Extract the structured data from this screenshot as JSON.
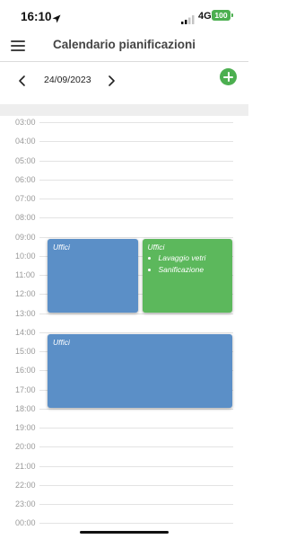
{
  "status_bar": {
    "time": "16:10",
    "network": "4G",
    "battery": "100",
    "location_icon": "location-arrow-icon",
    "signal_icon": "signal-bars-icon"
  },
  "header": {
    "title": "Calendario pianificazioni",
    "menu_icon": "hamburger-menu-icon"
  },
  "date_nav": {
    "date": "24/09/2023",
    "prev_icon": "chevron-left-icon",
    "next_icon": "chevron-right-icon",
    "add_icon": "add-circle-icon"
  },
  "timeline": {
    "hours": [
      "03:00",
      "04:00",
      "05:00",
      "06:00",
      "07:00",
      "08:00",
      "09:00",
      "10:00",
      "11:00",
      "12:00",
      "13:00",
      "14:00",
      "15:00",
      "16:00",
      "17:00",
      "18:00",
      "19:00",
      "20:00",
      "21:00",
      "22:00",
      "23:00",
      "00:00"
    ]
  },
  "events": [
    {
      "title": "Uffici",
      "start": "09:00",
      "end": "13:00",
      "column": 0,
      "columns": 2,
      "color": "#5b8fc7",
      "tasks": []
    },
    {
      "title": "Uffici",
      "start": "09:00",
      "end": "13:00",
      "column": 1,
      "columns": 2,
      "color": "#5cb85c",
      "tasks": [
        "Lavaggio vetri",
        "Sanificazione"
      ]
    },
    {
      "title": "Uffici",
      "start": "14:00",
      "end": "18:00",
      "column": 0,
      "columns": 1,
      "color": "#5b8fc7",
      "tasks": []
    }
  ],
  "colors": {
    "accent_green": "#4caf50",
    "event_blue": "#5b8fc7",
    "event_green": "#5cb85c"
  }
}
